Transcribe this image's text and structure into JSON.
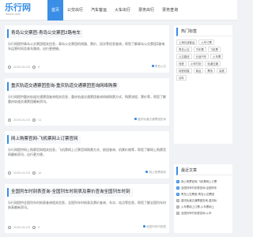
{
  "logo": {
    "main": "乐行网",
    "sub": "lexxlx.com"
  },
  "nav": [
    {
      "label": "首页",
      "active": true
    },
    {
      "label": "公交出行"
    },
    {
      "label": "汽车客运"
    },
    {
      "label": "火车出行"
    },
    {
      "label": "票务出行"
    },
    {
      "label": "票务查询"
    }
  ],
  "articles": [
    {
      "title": "青岛公交票团-青岛公交票团2路电车",
      "desc": "乐行网提供青岛公交票团相关信息，青岛公交票团的线路、票价、班次等信息查询，帮您了解青岛公交票团2路电车运营时间及乘车路线，出行更便捷。",
      "date": "2025-01-03",
      "views": "9",
      "tag": "青岛公交"
    },
    {
      "title": "重庆轨道交通票团查询-重庆轨道交通票团查询网络购票",
      "desc": "乐行网提供重庆轨道交通票团查询相关信息，重庆轨道交通票团查询网络购票方式、购票流程、票价等，帮您了解重庆轨道交通票团最新资讯。",
      "date": "2025-01-03",
      "views": "11",
      "tag": "重庆轨道交通票团查询"
    },
    {
      "title": "网上购票官网-飞机票网上订票官网",
      "desc": "乐行网提供网上购票官网相关信息，飞机票网上订票官网购票方式、航班查询、机票价格等，帮您了解网上购票官网最新资讯，出行更方便。",
      "date": "2025-01-03",
      "views": "10",
      "tag": "网上购票官网"
    },
    {
      "title": "全国列车时刻表查询-全国列车时刻表及票价查询全国列车时刻",
      "desc": "乐行网提供全国列车时刻表查询相关信息，全国列车时刻表及票价查询、车次、站点等信息，帮您了解全国列车时刻表最新资讯。",
      "date": "2025-01-03",
      "views": "9",
      "tag": "全国列车时刻表"
    }
  ],
  "hot_tags": {
    "heading": "热门标签",
    "items": [
      "上海长途客运",
      "火车订票",
      "青岛公交",
      "汽车票",
      "飞机票",
      "公交路线",
      "长途汽车",
      "火车票",
      "地铁",
      "火车时刻",
      "轨道交通",
      "地铁线路",
      "客运",
      "票务",
      "高铁",
      "动车"
    ]
  },
  "recent": {
    "heading": "最近文章",
    "items": [
      "网上购票官网-飞机票网上订票",
      "全国列车时刻表查询-全国列车",
      "青岛公交票团-青岛公交票团",
      "重庆轨道交通票团查询-重庆轨",
      "火车票网上订票-火车票网上",
      "全国列车时刻表查询-火车"
    ]
  }
}
